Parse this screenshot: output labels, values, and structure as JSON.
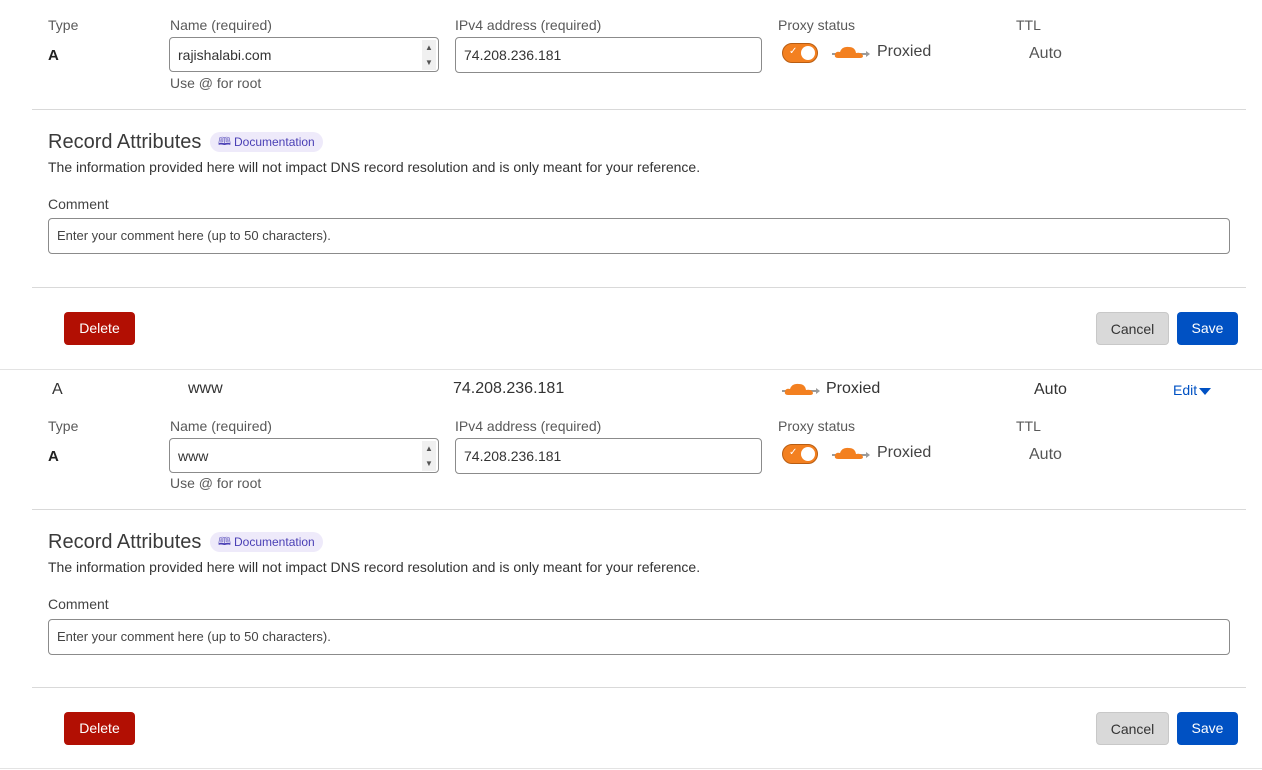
{
  "labels": {
    "type": "Type",
    "name": "Name (required)",
    "ipv4": "IPv4 address (required)",
    "proxy": "Proxy status",
    "ttl": "TTL",
    "hint": "Use @ for root",
    "proxied": "Proxied",
    "attr_title": "Record Attributes",
    "doc": "Documentation",
    "attr_desc": "The information provided here will not impact DNS record resolution and is only meant for your reference.",
    "comment": "Comment",
    "comment_placeholder": "Enter your comment here (up to 50 characters).",
    "delete": "Delete",
    "cancel": "Cancel",
    "save": "Save",
    "edit": "Edit"
  },
  "record1": {
    "type": "A",
    "name": "rajishalabi.com",
    "ipv4": "74.208.236.181",
    "ttl": "Auto",
    "proxy_on": true
  },
  "row2": {
    "type": "A",
    "name": "www",
    "content": "74.208.236.181",
    "proxy": "Proxied",
    "ttl": "Auto"
  },
  "record2": {
    "type": "A",
    "name": "www",
    "ipv4": "74.208.236.181",
    "ttl": "Auto",
    "proxy_on": true
  },
  "colors": {
    "accent": "#f38020",
    "delete": "#b20f03",
    "save": "#0051c3"
  },
  "icons": {
    "cloud": "cloud-icon",
    "book": "book-icon",
    "check": "check-icon",
    "caret": "caret-down-icon"
  }
}
